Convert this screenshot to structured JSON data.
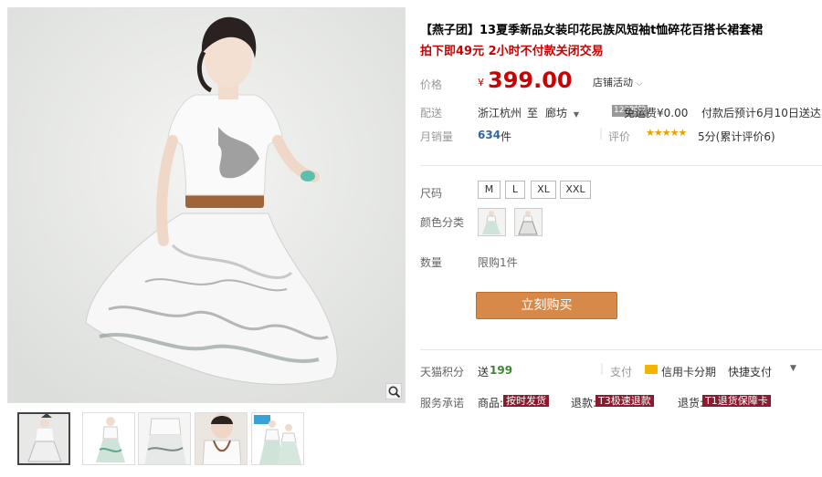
{
  "product": {
    "title": "【燕子团】13夏季新品女装印花民族风短袖t恤碎花百搭长裙套裙",
    "promo": "拍下即49元 2小时不付款关闭交易"
  },
  "price": {
    "label": "价格",
    "currency": "¥",
    "value": "399.00",
    "activity_label": "店铺活动"
  },
  "shipping": {
    "label": "配送",
    "from": "浙江杭州",
    "to_word": "至",
    "to": "廊坊",
    "badge": "123时效",
    "fee": "免运费¥0.00",
    "note": "付款后预计6月10日送达"
  },
  "sales": {
    "label": "月销量",
    "count": "634",
    "unit": "件",
    "rating_label": "评价",
    "stars": "★★★★★",
    "rating_text": "5分(累计评价6)"
  },
  "size": {
    "label": "尺码",
    "options": [
      "M",
      "L",
      "XL",
      "XXL"
    ]
  },
  "color": {
    "label": "颜色分类"
  },
  "quantity": {
    "label": "数量",
    "limit": "限购1件"
  },
  "buy_button": "立刻购买",
  "points": {
    "label": "天猫积分",
    "prefix": "送",
    "value": "199",
    "pay_label": "支付",
    "credit": "信用卡分期",
    "quick": "快捷支付"
  },
  "service": {
    "label": "服务承诺",
    "goods_label": "商品:",
    "goods_tag": "按时发货",
    "refund_label": "退款:",
    "refund_tag": "T3极速退款",
    "return_label": "退货:",
    "return_tag": "T1退货保障卡"
  },
  "colors": {
    "price_red": "#cc0000",
    "buy_orange": "#d7894a",
    "star_yellow": "#e8a200",
    "tag_maroon": "#8b1a2e"
  },
  "icons": [
    "zoom-icon",
    "chevron-down-icon",
    "credit-card-icon"
  ]
}
